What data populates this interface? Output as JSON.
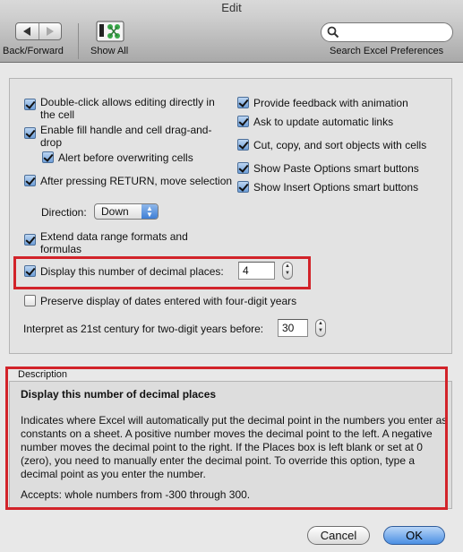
{
  "window": {
    "title": "Edit"
  },
  "toolbar": {
    "nav_label": "Back/Forward",
    "show_all_label": "Show All",
    "search_placeholder": "",
    "search_label": "Search Excel Preferences"
  },
  "settings": {
    "left": {
      "double_click_line1": "Double-click allows editing directly in",
      "double_click_line2": "the cell",
      "fill_handle_line1": "Enable fill handle and cell drag-and-",
      "fill_handle_line2": "drop",
      "alert_overwrite": "Alert before overwriting cells",
      "after_return": "After pressing RETURN, move selection",
      "direction_label": "Direction:",
      "direction_value": "Down",
      "extend_line1": "Extend data range formats and",
      "extend_line2": "formulas"
    },
    "right": {
      "feedback_animation": "Provide feedback with animation",
      "update_links": "Ask to update automatic links",
      "cut_copy_sort": "Cut, copy, and sort objects with cells",
      "paste_options": "Show Paste Options smart buttons",
      "insert_options": "Show Insert Options smart buttons"
    },
    "decimal_places_label": "Display this number of decimal places:",
    "decimal_places_value": "4",
    "preserve_dates": "Preserve display of dates entered with four-digit years",
    "century_label": "Interpret as 21st century for two-digit years before:",
    "century_value": "30"
  },
  "description": {
    "legend": "Description",
    "title": "Display this number of decimal places",
    "body": "Indicates where Excel will automatically put the decimal point in the numbers you enter as constants on a sheet. A positive number moves the decimal point to the left. A negative number moves the decimal point to the right. If the Places box is left blank or set at 0 (zero), you need to manually enter the decimal point. To override this option, type a decimal point as you enter the number.",
    "accepts": "Accepts: whole numbers from -300 through 300."
  },
  "buttons": {
    "cancel": "Cancel",
    "ok": "OK"
  },
  "colors": {
    "highlight": "#d2232a",
    "accent": "#4b8fe3"
  }
}
